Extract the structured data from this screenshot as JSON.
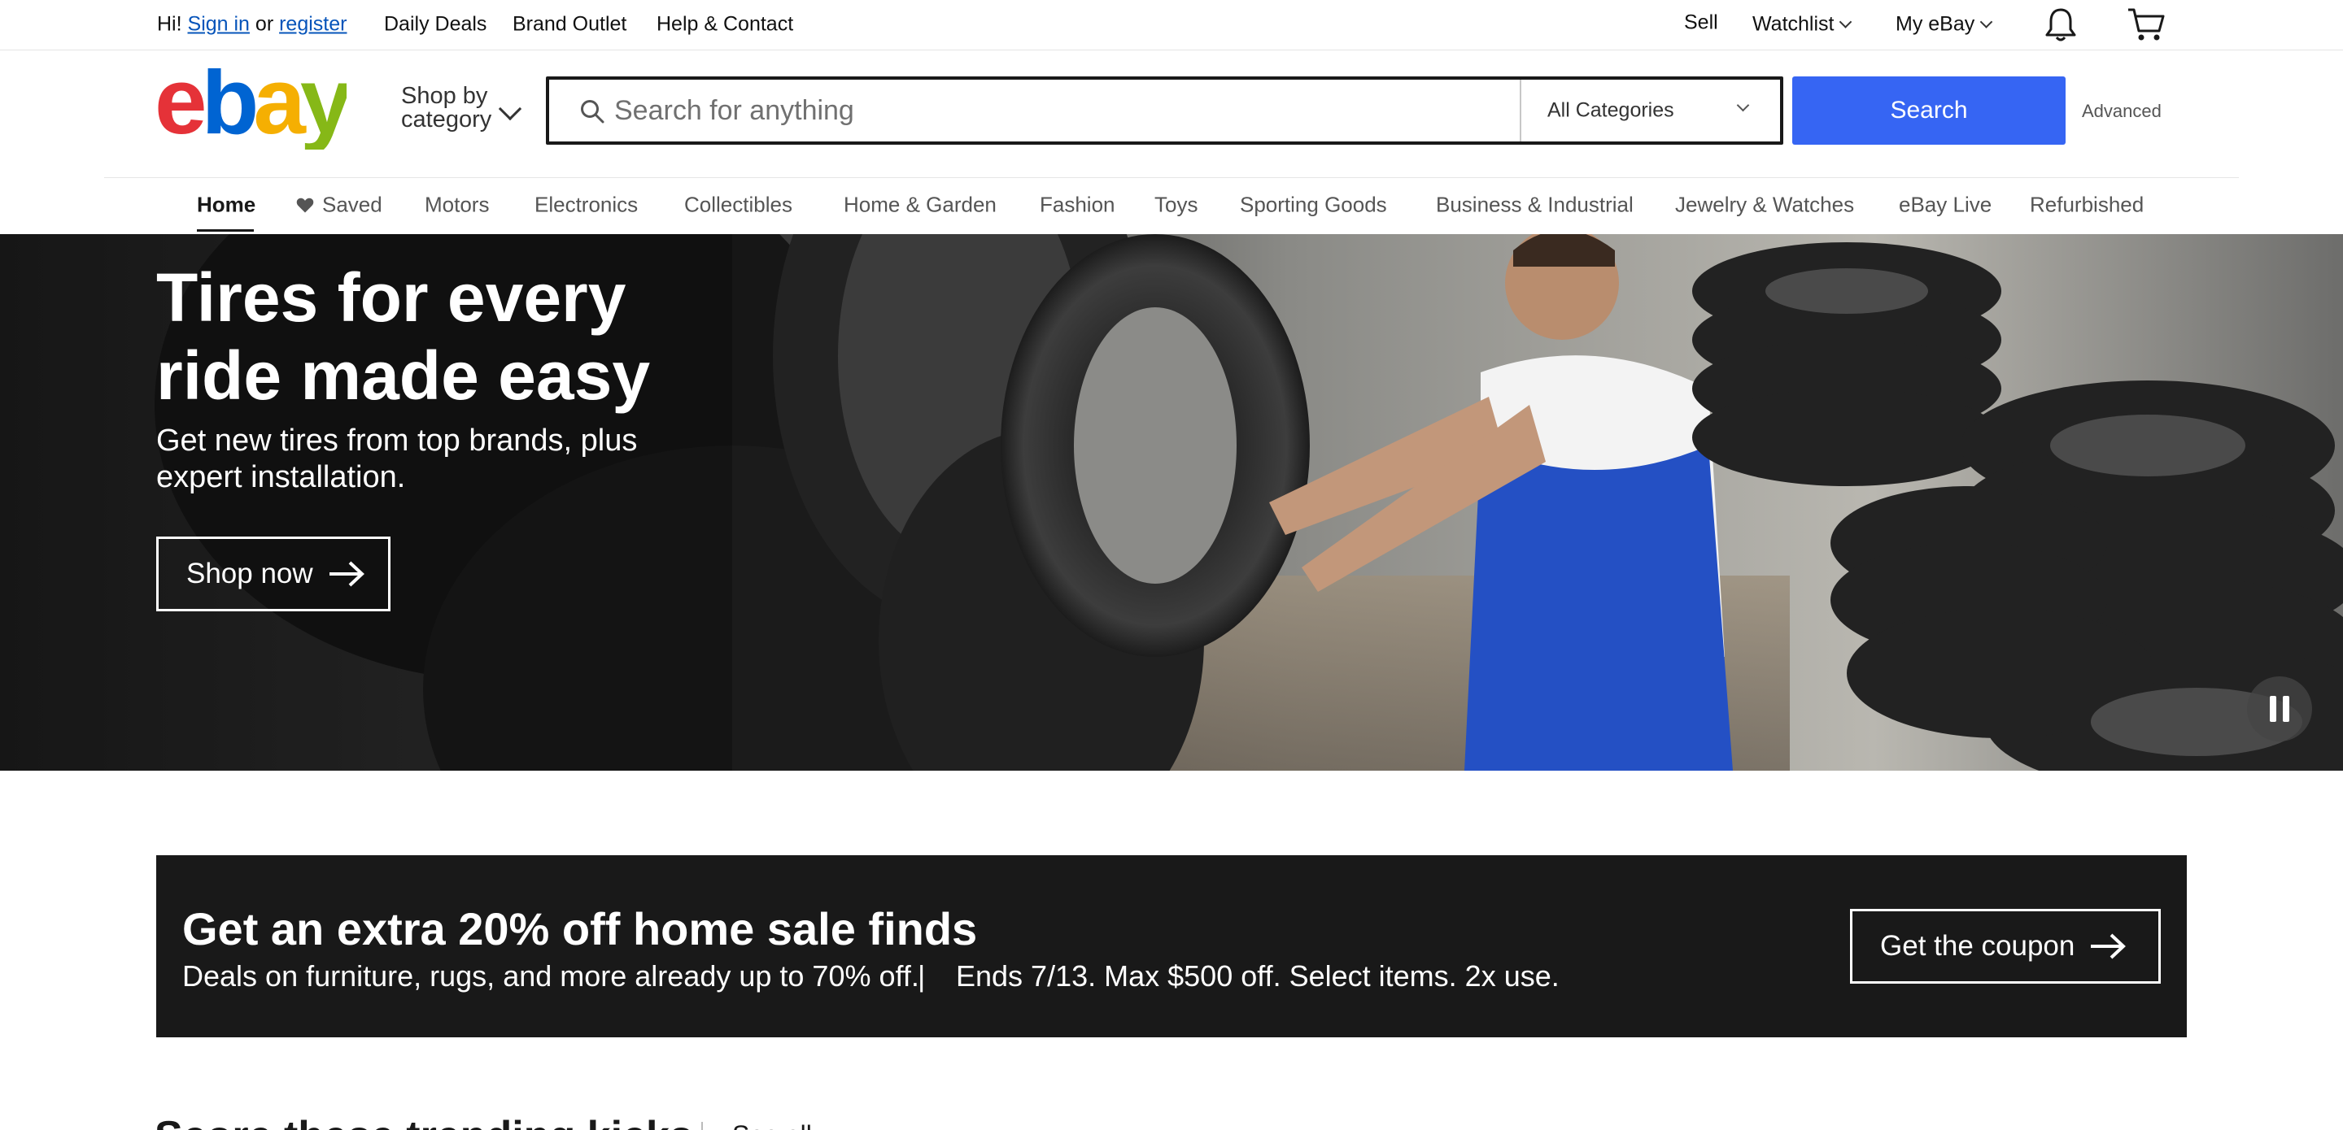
{
  "topbar": {
    "greeting": "Hi!",
    "sign_in": "Sign in",
    "or": "or",
    "register": "register",
    "daily_deals": "Daily Deals",
    "brand_outlet": "Brand Outlet",
    "help": "Help & Contact",
    "sell": "Sell",
    "watchlist": "Watchlist",
    "my_ebay": "My eBay"
  },
  "header": {
    "shop_by_category": "Shop by category",
    "search_placeholder": "Search for anything",
    "category_value": "All Categories",
    "search_button": "Search",
    "advanced": "Advanced"
  },
  "nav": {
    "items": [
      {
        "label": "Home"
      },
      {
        "label": "Saved"
      },
      {
        "label": "Motors"
      },
      {
        "label": "Electronics"
      },
      {
        "label": "Collectibles"
      },
      {
        "label": "Home & Garden"
      },
      {
        "label": "Fashion"
      },
      {
        "label": "Toys"
      },
      {
        "label": "Sporting Goods"
      },
      {
        "label": "Business & Industrial"
      },
      {
        "label": "Jewelry & Watches"
      },
      {
        "label": "eBay Live"
      },
      {
        "label": "Refurbished"
      }
    ]
  },
  "hero": {
    "title": "Tires for every ride made easy",
    "subtitle": "Get new tires from top brands, plus expert installation.",
    "button": "Shop now"
  },
  "promo": {
    "title": "Get an extra 20% off home sale finds",
    "subtitle": "Deals on furniture, rugs, and more already up to 70% off.",
    "separator": "|",
    "terms": "Ends 7/13. Max $500 off. Select items. 2x use.",
    "button": "Get the coupon"
  },
  "section": {
    "title": "Score these trending kicks",
    "link": "See all"
  },
  "colors": {
    "accent": "#3665f3",
    "link": "#0654ba",
    "promo_bg": "#191919",
    "logo_e": "#e53238",
    "logo_b": "#0064d2",
    "logo_a": "#f5af02",
    "logo_y": "#86b817"
  },
  "icons": [
    "search-icon",
    "chevron-down-icon",
    "bell-icon",
    "cart-icon",
    "heart-icon",
    "arrow-right-icon",
    "pause-icon"
  ]
}
